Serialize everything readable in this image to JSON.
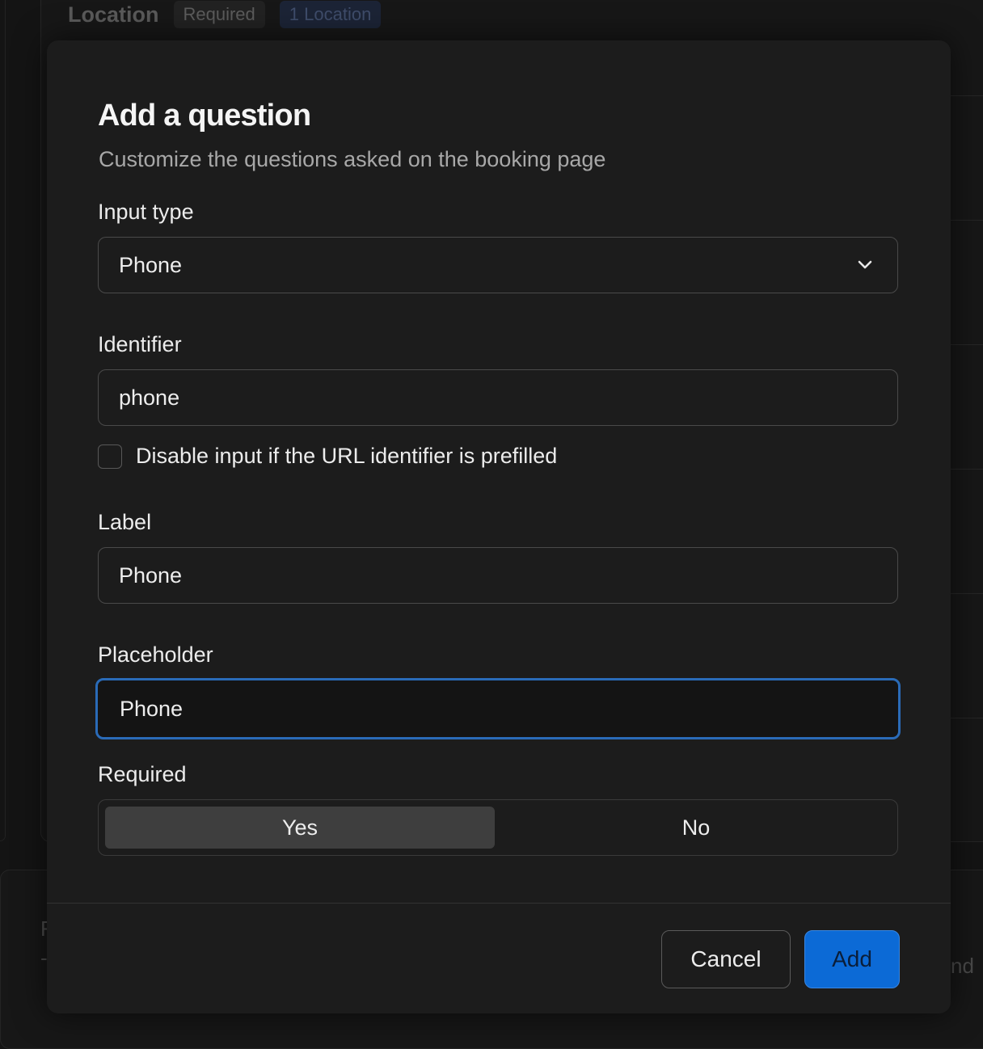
{
  "background": {
    "section_title": "Location",
    "required_badge": "Required",
    "location_badge": "1 Location",
    "right_stub": "nd",
    "left_stub_1": "F",
    "left_stub_2": "-"
  },
  "dialog": {
    "title": "Add a question",
    "subtitle": "Customize the questions asked on the booking page",
    "input_type": {
      "label": "Input type",
      "value": "Phone",
      "icon": "chevron-down-icon"
    },
    "identifier": {
      "label": "Identifier",
      "value": "phone"
    },
    "disable_prefilled": {
      "label": "Disable input if the URL identifier is prefilled",
      "checked": false
    },
    "label_field": {
      "label": "Label",
      "value": "Phone"
    },
    "placeholder_field": {
      "label": "Placeholder",
      "value": "Phone"
    },
    "required": {
      "label": "Required",
      "options": [
        "Yes",
        "No"
      ],
      "selected": "Yes"
    },
    "cancel_label": "Cancel",
    "add_label": "Add"
  },
  "colors": {
    "accent": "#0c6ad6",
    "focus_ring": "#2a6bb8",
    "modal_bg": "#1c1c1c"
  }
}
